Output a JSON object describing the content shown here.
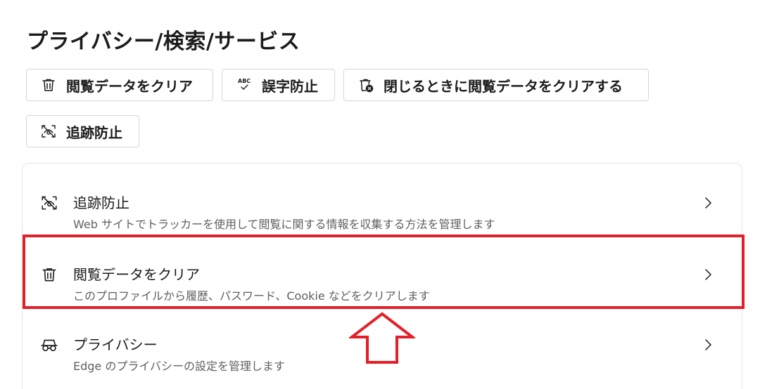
{
  "page": {
    "title": "プライバシー/検索/サービス"
  },
  "quick_actions": [
    {
      "label": "閲覧データをクリア",
      "icon": "trash-icon"
    },
    {
      "label": "誤字防止",
      "icon": "spellcheck-icon"
    },
    {
      "label": "閉じるときに閲覧データをクリアする",
      "icon": "trash-close-icon"
    },
    {
      "label": "追跡防止",
      "icon": "tracking-prevention-icon"
    }
  ],
  "settings_list": [
    {
      "title": "追跡防止",
      "description": "Web サイトでトラッカーを使用して閲覧に関する情報を収集する方法を管理します",
      "icon": "tracking-prevention-icon"
    },
    {
      "title": "閲覧データをクリア",
      "description": "このプロファイルから履歴、パスワード、Cookie などをクリアします",
      "icon": "trash-icon"
    },
    {
      "title": "プライバシー",
      "description": "Edge のプライバシーの設定を管理します",
      "icon": "glasses-icon"
    }
  ],
  "spellcheck_icon_text": "ABC",
  "colors": {
    "annotation_red": "#e3202a",
    "text_primary": "#1b1b1b",
    "text_secondary": "#5f5f5f",
    "border": "#d6d6d6"
  }
}
